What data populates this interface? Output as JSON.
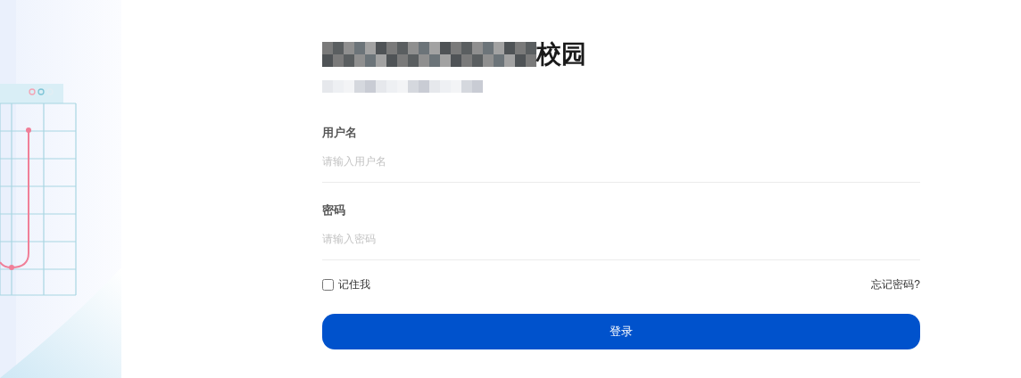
{
  "title": {
    "visible_text": "校园"
  },
  "fields": [
    {
      "label": "用户名",
      "placeholder": "请输入用户名"
    },
    {
      "label": "密码",
      "placeholder": "请输入密码"
    }
  ],
  "remember": {
    "label": "记住我",
    "checked": false
  },
  "forgot_link": "忘记密码?",
  "login_button": "登录"
}
